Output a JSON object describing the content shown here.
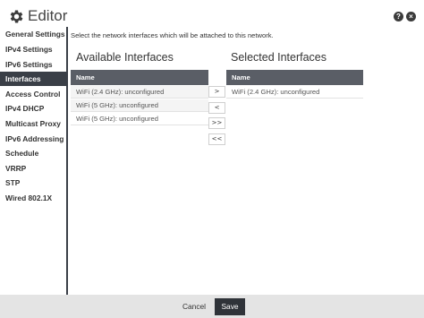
{
  "header": {
    "title": "Editor",
    "gear_icon": "gear-icon",
    "help_glyph": "?",
    "close_glyph": "×"
  },
  "sidebar": {
    "items": [
      {
        "label": "General Settings"
      },
      {
        "label": "IPv4 Settings"
      },
      {
        "label": "IPv6 Settings"
      },
      {
        "label": "Interfaces",
        "active": true
      },
      {
        "label": "Access Control"
      },
      {
        "label": "IPv4 DHCP"
      },
      {
        "label": "Multicast Proxy"
      },
      {
        "label": "IPv6 Addressing"
      },
      {
        "label": "Schedule"
      },
      {
        "label": "VRRP"
      },
      {
        "label": "STP"
      },
      {
        "label": "Wired 802.1X"
      }
    ]
  },
  "main": {
    "intro": "Select the network interfaces which will be attached to this network.",
    "available": {
      "title": "Available Interfaces",
      "column": "Name",
      "rows": [
        "WiFi (2.4 GHz): unconfigured",
        "WiFi (5 GHz): unconfigured",
        "WiFi (5 GHz): unconfigured"
      ]
    },
    "selected": {
      "title": "Selected Interfaces",
      "column": "Name",
      "rows": [
        "WiFi (2.4 GHz): unconfigured"
      ]
    },
    "move_buttons": {
      "add": ">",
      "remove": "<",
      "add_all": ">>",
      "remove_all": "<<"
    }
  },
  "footer": {
    "cancel_label": "Cancel",
    "save_label": "Save"
  },
  "colors": {
    "sidebar_active": "#3a3f47",
    "table_header": "#5a5e66",
    "save_button": "#2f3339",
    "footer_bg": "#e4e4e4"
  }
}
